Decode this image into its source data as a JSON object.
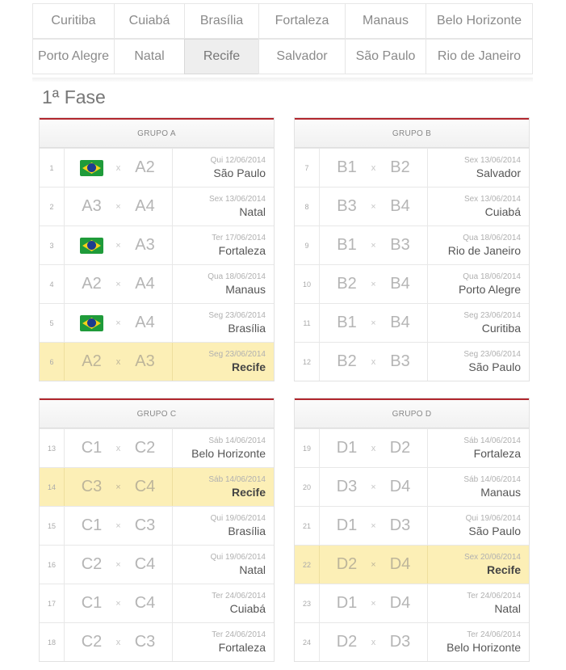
{
  "tabs": {
    "row1": [
      "Curitiba",
      "Cuiabá",
      "Brasília",
      "Fortaleza",
      "Manaus",
      "Belo Horizonte"
    ],
    "row2": [
      "Porto Alegre",
      "Natal",
      "Recife",
      "Salvador",
      "São Paulo",
      "Rio de Janeiro"
    ],
    "active": "Recife"
  },
  "phase_title": "1ª Fase",
  "colors": {
    "accent": "#b2272e",
    "highlight": "#fcefb6",
    "flag_green": "#1f9b3a",
    "flag_yellow": "#f5d11a",
    "flag_blue": "#1d3c8f"
  },
  "groups": [
    {
      "name": "GRUPO A",
      "matches": [
        {
          "num": "1",
          "home": "BRA",
          "vs": "x",
          "away": "A2",
          "date": "Qui 12/06/2014",
          "city": "São Paulo"
        },
        {
          "num": "2",
          "home": "A3",
          "vs": "×",
          "away": "A4",
          "date": "Sex 13/06/2014",
          "city": "Natal"
        },
        {
          "num": "3",
          "home": "BRA",
          "vs": "×",
          "away": "A3",
          "date": "Ter 17/06/2014",
          "city": "Fortaleza"
        },
        {
          "num": "4",
          "home": "A2",
          "vs": "×",
          "away": "A4",
          "date": "Qua 18/06/2014",
          "city": "Manaus"
        },
        {
          "num": "5",
          "home": "BRA",
          "vs": "×",
          "away": "A4",
          "date": "Seg 23/06/2014",
          "city": "Brasília"
        },
        {
          "num": "6",
          "home": "A2",
          "vs": "x",
          "away": "A3",
          "date": "Seg 23/06/2014",
          "city": "Recife",
          "highlight": true
        }
      ]
    },
    {
      "name": "GRUPO B",
      "matches": [
        {
          "num": "7",
          "home": "B1",
          "vs": "x",
          "away": "B2",
          "date": "Sex 13/06/2014",
          "city": "Salvador"
        },
        {
          "num": "8",
          "home": "B3",
          "vs": "×",
          "away": "B4",
          "date": "Sex 13/06/2014",
          "city": "Cuiabá"
        },
        {
          "num": "9",
          "home": "B1",
          "vs": "×",
          "away": "B3",
          "date": "Qua 18/06/2014",
          "city": "Rio de Janeiro"
        },
        {
          "num": "10",
          "home": "B2",
          "vs": "×",
          "away": "B4",
          "date": "Qua 18/06/2014",
          "city": "Porto Alegre"
        },
        {
          "num": "11",
          "home": "B1",
          "vs": "×",
          "away": "B4",
          "date": "Seg 23/06/2014",
          "city": "Curitiba"
        },
        {
          "num": "12",
          "home": "B2",
          "vs": "x",
          "away": "B3",
          "date": "Seg 23/06/2014",
          "city": "São Paulo"
        }
      ]
    },
    {
      "name": "GRUPO C",
      "matches": [
        {
          "num": "13",
          "home": "C1",
          "vs": "x",
          "away": "C2",
          "date": "Sáb 14/06/2014",
          "city": "Belo Horizonte"
        },
        {
          "num": "14",
          "home": "C3",
          "vs": "×",
          "away": "C4",
          "date": "Sáb 14/06/2014",
          "city": "Recife",
          "highlight": true
        },
        {
          "num": "15",
          "home": "C1",
          "vs": "×",
          "away": "C3",
          "date": "Qui 19/06/2014",
          "city": "Brasília"
        },
        {
          "num": "16",
          "home": "C2",
          "vs": "×",
          "away": "C4",
          "date": "Qui 19/06/2014",
          "city": "Natal"
        },
        {
          "num": "17",
          "home": "C1",
          "vs": "×",
          "away": "C4",
          "date": "Ter 24/06/2014",
          "city": "Cuiabá"
        },
        {
          "num": "18",
          "home": "C2",
          "vs": "x",
          "away": "C3",
          "date": "Ter 24/06/2014",
          "city": "Fortaleza"
        }
      ]
    },
    {
      "name": "GRUPO D",
      "matches": [
        {
          "num": "19",
          "home": "D1",
          "vs": "x",
          "away": "D2",
          "date": "Sáb 14/06/2014",
          "city": "Fortaleza"
        },
        {
          "num": "20",
          "home": "D3",
          "vs": "×",
          "away": "D4",
          "date": "Sáb 14/06/2014",
          "city": "Manaus"
        },
        {
          "num": "21",
          "home": "D1",
          "vs": "×",
          "away": "D3",
          "date": "Qui 19/06/2014",
          "city": "São Paulo"
        },
        {
          "num": "22",
          "home": "D2",
          "vs": "×",
          "away": "D4",
          "date": "Sex 20/06/2014",
          "city": "Recife",
          "highlight": true
        },
        {
          "num": "23",
          "home": "D1",
          "vs": "×",
          "away": "D4",
          "date": "Ter 24/06/2014",
          "city": "Natal"
        },
        {
          "num": "24",
          "home": "D2",
          "vs": "x",
          "away": "D3",
          "date": "Ter 24/06/2014",
          "city": "Belo Horizonte"
        }
      ]
    }
  ]
}
